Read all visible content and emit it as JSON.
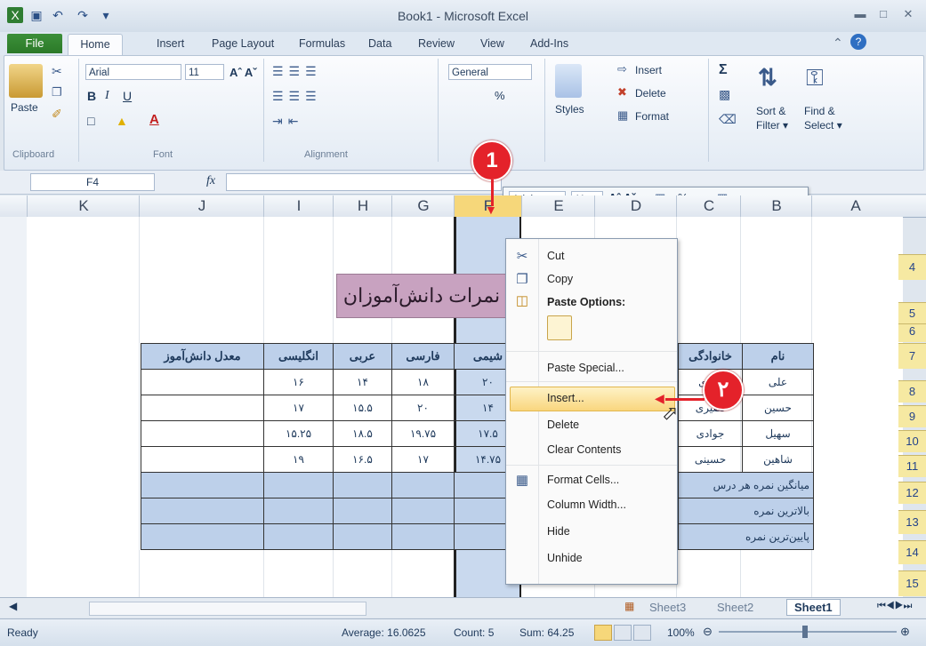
{
  "window": {
    "title": "Book1 - Microsoft Excel"
  },
  "qat": {
    "save_icon": "save-icon",
    "undo_icon": "undo-icon",
    "redo_icon": "redo-icon"
  },
  "tabs": [
    "File",
    "Home",
    "Insert",
    "Page Layout",
    "Formulas",
    "Data",
    "Review",
    "View",
    "Add-Ins"
  ],
  "ribbon": {
    "clipboard": {
      "paste": "Paste",
      "label": "Clipboard"
    },
    "font": {
      "name": "Arial",
      "size": "11",
      "label": "Font"
    },
    "alignment": {
      "label": "Alignment"
    },
    "number": {
      "format": "General",
      "percent": "%"
    },
    "styles": {
      "label": "Styles"
    },
    "cells": {
      "insert": "Insert",
      "delete": "Delete",
      "format": "Format"
    },
    "editing": {
      "sort": "Sort &",
      "sort2": "Filter",
      "find": "Find &",
      "find2": "Select"
    }
  },
  "formula_bar": {
    "name_box": "F4",
    "fx": "fx"
  },
  "columns": [
    "K",
    "J",
    "I",
    "H",
    "G",
    "F",
    "E",
    "D",
    "C",
    "B",
    "A"
  ],
  "rows": [
    "4",
    "5",
    "6",
    "7",
    "8",
    "9",
    "10",
    "11",
    "12",
    "13",
    "14",
    "15"
  ],
  "sheet": {
    "title": "نمرات دانش‌آموزان",
    "headers": [
      "معدل دانش‌آموز",
      "انگلیسی",
      "عربی",
      "فارسی",
      "شیمی",
      "",
      "خانوادگی",
      "نام"
    ],
    "rows": [
      [
        "",
        "۱۶",
        "۱۴",
        "۱۸",
        "۲۰",
        "",
        "علوی",
        "علی"
      ],
      [
        "",
        "۱۷",
        "۱۵.۵",
        "۲۰",
        "۱۴",
        "",
        "نصیری",
        "حسین"
      ],
      [
        "",
        "۱۵.۲۵",
        "۱۸.۵",
        "۱۹.۷۵",
        "۱۷.۵",
        "",
        "جوادی",
        "سهیل"
      ],
      [
        "",
        "۱۹",
        "۱۶.۵",
        "۱۷",
        "۱۴.۷۵",
        "",
        "حسینی",
        "شاهین"
      ]
    ],
    "footer": [
      "میانگین نمره هر درس",
      "بالاترین نمره",
      "پایین‌ترین نمره"
    ]
  },
  "mini_toolbar": {
    "font": "Arial",
    "size": "11"
  },
  "context_menu": {
    "items": [
      "Cut",
      "Copy",
      "Paste Options:",
      "Paste Special...",
      "Insert...",
      "Delete",
      "Clear Contents",
      "Format Cells...",
      "Column Width...",
      "Hide",
      "Unhide"
    ]
  },
  "markers": {
    "one": "1",
    "two": "۲"
  },
  "sheet_tabs": [
    "Sheet3",
    "Sheet2",
    "Sheet1"
  ],
  "status": {
    "ready": "Ready",
    "average": "Average: 16.0625",
    "count": "Count: 5",
    "sum": "Sum: 64.25",
    "zoom": "100%"
  }
}
